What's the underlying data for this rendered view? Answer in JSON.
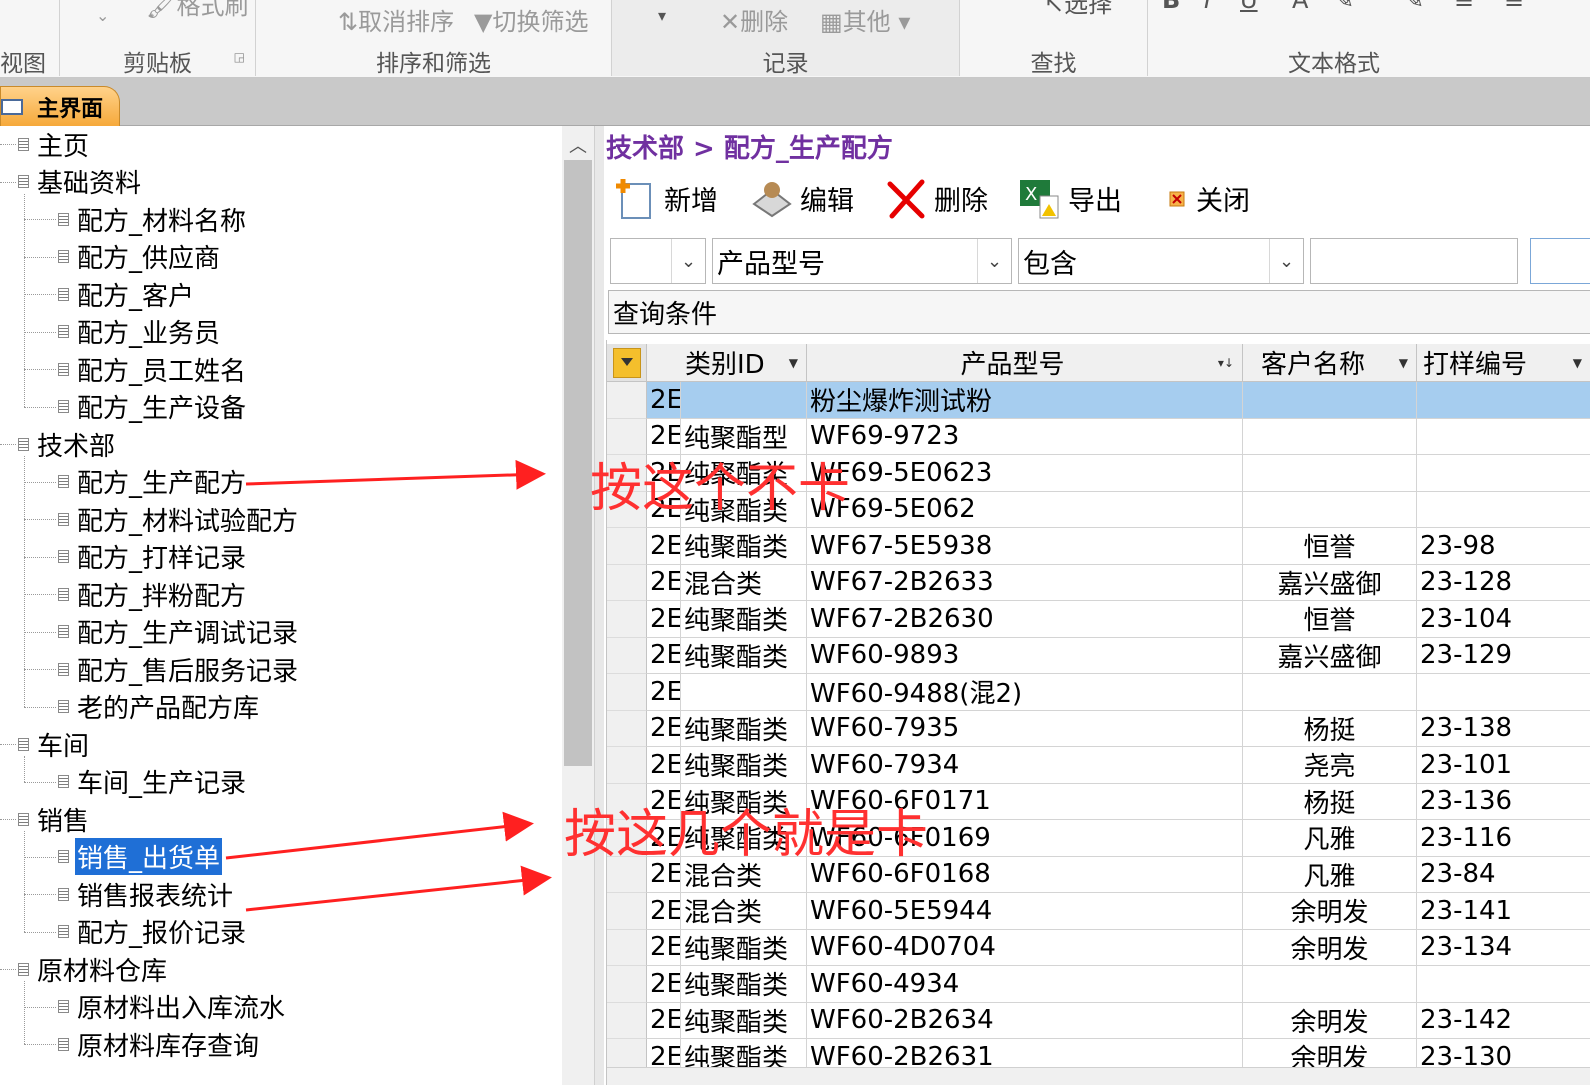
{
  "ribbon": {
    "groups": [
      {
        "label": "视图",
        "tools": []
      },
      {
        "label": "剪贴板",
        "tools": [
          "格式刷"
        ]
      },
      {
        "label": "排序和筛选",
        "tools": [
          "取消排序",
          "切换筛选"
        ]
      },
      {
        "label": "记录",
        "tools": [
          "删除",
          "其他"
        ]
      },
      {
        "label": "查找",
        "tools": [
          "选择"
        ]
      },
      {
        "label": "文本格式",
        "tools": [
          "B",
          "I",
          "U",
          "A"
        ]
      }
    ]
  },
  "tab": {
    "title": "主界面"
  },
  "tree": [
    {
      "label": "主页",
      "level": 0
    },
    {
      "label": "基础资料",
      "level": 0
    },
    {
      "label": "配方_材料名称",
      "level": 1
    },
    {
      "label": "配方_供应商",
      "level": 1
    },
    {
      "label": "配方_客户",
      "level": 1
    },
    {
      "label": "配方_业务员",
      "level": 1
    },
    {
      "label": "配方_员工姓名",
      "level": 1
    },
    {
      "label": "配方_生产设备",
      "level": 1
    },
    {
      "label": "技术部",
      "level": 0
    },
    {
      "label": "配方_生产配方",
      "level": 1
    },
    {
      "label": "配方_材料试验配方",
      "level": 1
    },
    {
      "label": "配方_打样记录",
      "level": 1
    },
    {
      "label": "配方_拌粉配方",
      "level": 1
    },
    {
      "label": "配方_生产调试记录",
      "level": 1
    },
    {
      "label": "配方_售后服务记录",
      "level": 1
    },
    {
      "label": "老的产品配方库",
      "level": 1
    },
    {
      "label": "车间",
      "level": 0
    },
    {
      "label": "车间_生产记录",
      "level": 1
    },
    {
      "label": "销售",
      "level": 0
    },
    {
      "label": "销售_出货单",
      "level": 1,
      "selected": true
    },
    {
      "label": "销售报表统计",
      "level": 1
    },
    {
      "label": "配方_报价记录",
      "level": 1
    },
    {
      "label": "原材料仓库",
      "level": 0
    },
    {
      "label": "原材料出入库流水",
      "level": 1
    },
    {
      "label": "原材料库存查询",
      "level": 1
    }
  ],
  "form": {
    "breadcrumb": "技术部 > 配方_生产配方",
    "toolbar": {
      "add": "新增",
      "edit": "编辑",
      "delete": "删除",
      "export": "导出",
      "close": "关闭"
    },
    "filter": {
      "prefix": "",
      "field": "产品型号",
      "operator": "包含",
      "value": ""
    },
    "query_label": "查询条件"
  },
  "sheet": {
    "columns": [
      "类别ID",
      "产品型号",
      "客户名称",
      "打样编号"
    ],
    "rows": [
      {
        "id": "2E",
        "cat": "",
        "model": "粉尘爆炸测试粉",
        "cust": "",
        "no": ""
      },
      {
        "id": "2E",
        "cat": "纯聚酯型",
        "model": "WF69-9723",
        "cust": "",
        "no": ""
      },
      {
        "id": "2E",
        "cat": "纯聚酯类",
        "model": "WF69-5E0623",
        "cust": "",
        "no": ""
      },
      {
        "id": "2E",
        "cat": "纯聚酯类",
        "model": "WF69-5E062",
        "cust": "",
        "no": ""
      },
      {
        "id": "2E",
        "cat": "纯聚酯类",
        "model": "WF67-5E5938",
        "cust": "恒誉",
        "no": "23-98"
      },
      {
        "id": "2E",
        "cat": "混合类",
        "model": "WF67-2B2633",
        "cust": "嘉兴盛御",
        "no": "23-128"
      },
      {
        "id": "2E",
        "cat": "纯聚酯类",
        "model": "WF67-2B2630",
        "cust": "恒誉",
        "no": "23-104"
      },
      {
        "id": "2E",
        "cat": "纯聚酯类",
        "model": "WF60-9893",
        "cust": "嘉兴盛御",
        "no": "23-129"
      },
      {
        "id": "2E",
        "cat": "",
        "model": "WF60-9488(混2)",
        "cust": "",
        "no": ""
      },
      {
        "id": "2E",
        "cat": "纯聚酯类",
        "model": "WF60-7935",
        "cust": "杨挺",
        "no": "23-138"
      },
      {
        "id": "2E",
        "cat": "纯聚酯类",
        "model": "WF60-7934",
        "cust": "尧亮",
        "no": "23-101"
      },
      {
        "id": "2E",
        "cat": "纯聚酯类",
        "model": "WF60-6F0171",
        "cust": "杨挺",
        "no": "23-136"
      },
      {
        "id": "2E",
        "cat": "纯聚酯类",
        "model": "WF60-6F0169",
        "cust": "凡雅",
        "no": "23-116"
      },
      {
        "id": "2E",
        "cat": "混合类",
        "model": "WF60-6F0168",
        "cust": "凡雅",
        "no": "23-84"
      },
      {
        "id": "2E",
        "cat": "混合类",
        "model": "WF60-5E5944",
        "cust": "余明发",
        "no": "23-141"
      },
      {
        "id": "2E",
        "cat": "纯聚酯类",
        "model": "WF60-4D0704",
        "cust": "余明发",
        "no": "23-134"
      },
      {
        "id": "2E",
        "cat": "纯聚酯类",
        "model": "WF60-4934",
        "cust": "",
        "no": ""
      },
      {
        "id": "2E",
        "cat": "纯聚酯类",
        "model": "WF60-2B2634",
        "cust": "余明发",
        "no": "23-142"
      },
      {
        "id": "2E",
        "cat": "纯聚酯类",
        "model": "WF60-2B2631",
        "cust": "余明发",
        "no": "23-130"
      }
    ]
  },
  "annotations": {
    "top": "按这个不卡",
    "bottom": "按这几个就是卡"
  },
  "colors": {
    "accent_tab": "#f6a93b",
    "breadcrumb": "#7030a0",
    "selection": "#1f6fd6",
    "row_highlight": "#a6cdef",
    "annotation": "#ff3030"
  }
}
